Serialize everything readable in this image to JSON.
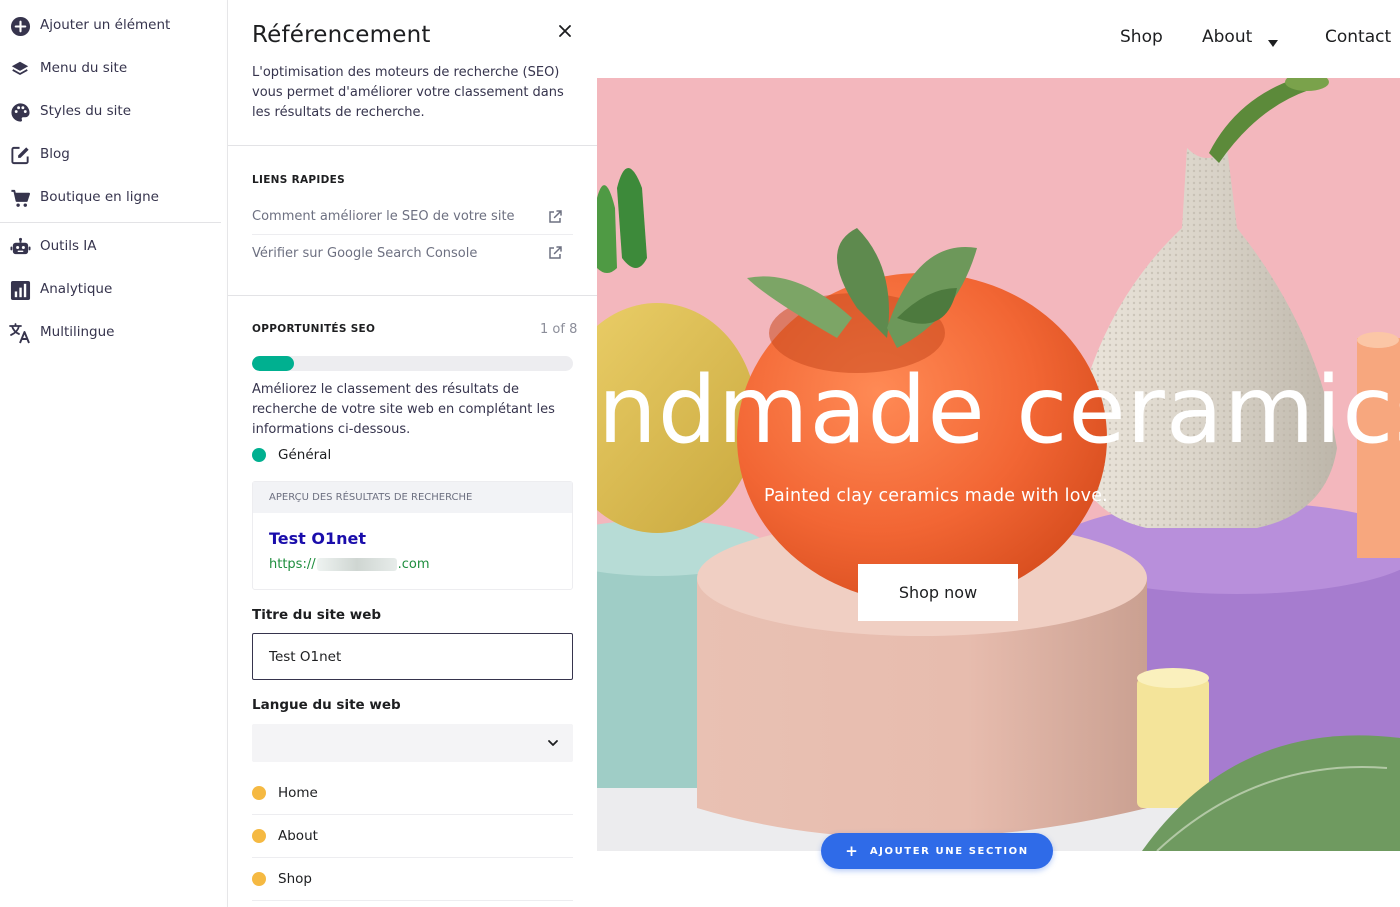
{
  "sidebar": {
    "items": [
      {
        "label": "Ajouter un élément",
        "icon": "plus-circle-icon"
      },
      {
        "label": "Menu du site",
        "icon": "layers-icon"
      },
      {
        "label": "Styles du site",
        "icon": "palette-icon"
      },
      {
        "label": "Blog",
        "icon": "edit-icon"
      },
      {
        "label": "Boutique en ligne",
        "icon": "cart-icon"
      },
      {
        "label": "Outils IA",
        "icon": "robot-icon"
      },
      {
        "label": "Analytique",
        "icon": "chart-icon"
      },
      {
        "label": "Multilingue",
        "icon": "translate-icon"
      }
    ]
  },
  "seo_panel": {
    "title": "Référencement",
    "description": "L'optimisation des moteurs de recherche (SEO) vous permet d'améliorer votre classement dans les résultats de recherche.",
    "quick_links": {
      "heading": "LIENS RAPIDES",
      "items": [
        {
          "label": "Comment améliorer le SEO de votre site"
        },
        {
          "label": "Vérifier sur Google Search Console"
        }
      ]
    },
    "opportunities": {
      "heading": "OPPORTUNITÉS SEO",
      "count": "1 of 8",
      "progress": 0.13,
      "note": "Améliorez le classement des résultats de recherche de votre site web en complétant les informations ci-dessous.",
      "current": "Général"
    },
    "search_preview": {
      "heading": "APERÇU DES RÉSULTATS DE RECHERCHE",
      "title": "Test O1net",
      "url_prefix": "https://",
      "url_suffix": ".com"
    },
    "site_title": {
      "label": "Titre du site web",
      "value": "Test O1net"
    },
    "site_language": {
      "label": "Langue du site web",
      "value": ""
    },
    "pages": [
      {
        "label": "Home"
      },
      {
        "label": "About"
      },
      {
        "label": "Shop"
      }
    ]
  },
  "site": {
    "nav": {
      "shop": "Shop",
      "about": "About",
      "contact": "Contact"
    },
    "hero": {
      "title": "Handmade ceramics",
      "subtitle": "Painted clay ceramics made with love.",
      "button": "Shop now"
    },
    "add_section": "AJOUTER UNE SECTION"
  },
  "colors": {
    "accent": "#2f6be8",
    "success": "#00b090",
    "warning": "#f5b942",
    "hero_background": "#f3b7bd"
  }
}
